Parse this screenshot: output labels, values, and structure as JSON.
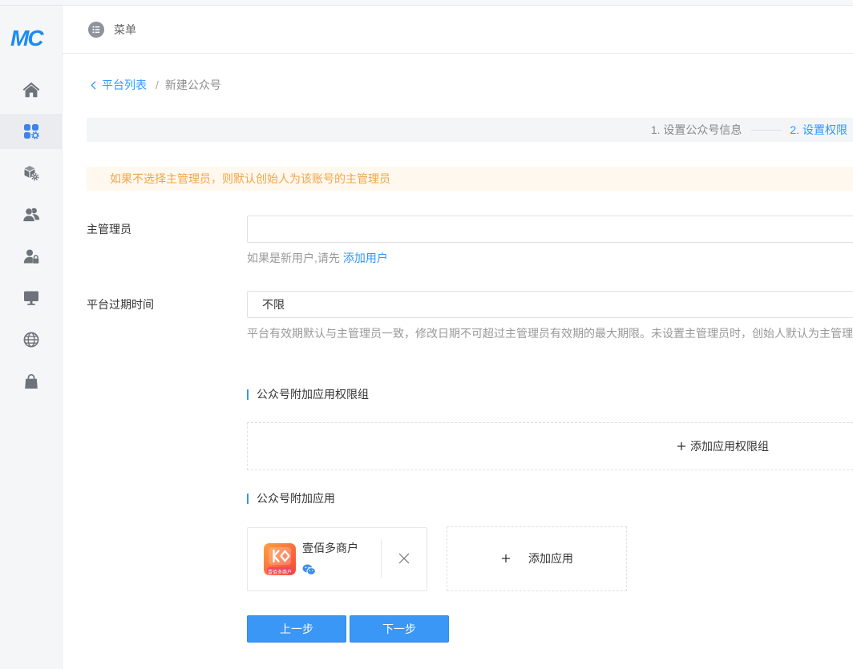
{
  "app": {
    "logo_text": "MC"
  },
  "sidebar": {
    "items": [
      {
        "icon": "home-icon",
        "active": false
      },
      {
        "icon": "apps-settings-icon",
        "active": true
      },
      {
        "icon": "cube-settings-icon",
        "active": false
      },
      {
        "icon": "users-icon",
        "active": false
      },
      {
        "icon": "user-lock-icon",
        "active": false
      },
      {
        "icon": "monitor-icon",
        "active": false
      },
      {
        "icon": "globe-icon",
        "active": false
      },
      {
        "icon": "shopping-bag-icon",
        "active": false
      }
    ]
  },
  "header": {
    "menu_icon": "menu-list-icon",
    "menu_label": "菜单"
  },
  "breadcrumb": {
    "back_icon": "chevron-left-icon",
    "parent": "平台列表",
    "separator": "/",
    "current": "新建公众号"
  },
  "steps": {
    "items": [
      {
        "label": "1. 设置公众号信息",
        "active": false
      },
      {
        "label": "2. 设置权限",
        "active": true
      }
    ]
  },
  "alert": {
    "text": "如果不选择主管理员，则默认创始人为该账号的主管理员"
  },
  "form": {
    "admin": {
      "label": "主管理员",
      "hint_prefix": "如果是新用户,请先",
      "hint_link": "添加用户"
    },
    "expire": {
      "label": "平台过期时间",
      "value": "不限",
      "help": "平台有效期默认与主管理员一致，修改日期不可超过主管理员有效期的最大期限。未设置主管理员时，创始人默认为主管理"
    }
  },
  "permission_groups": {
    "title": "公众号附加应用权限组",
    "add_icon": "plus-icon",
    "add_label": "添加应用权限组"
  },
  "apps": {
    "title": "公众号附加应用",
    "items": [
      {
        "name": "壹佰多商户",
        "icon_caption": "壹佰多商户",
        "platform_icon": "wechat-icon",
        "remove_icon": "close-icon"
      }
    ],
    "add_icon": "plus-icon",
    "add_label": "添加应用"
  },
  "actions": {
    "prev_label": "上一步",
    "next_label": "下一步"
  },
  "colors": {
    "primary": "#3296fa",
    "button": "#3a97f6",
    "warning_text": "#f0a64a",
    "warning_bg": "#fff8ee",
    "active_nav_icon": "#3e84e6"
  }
}
